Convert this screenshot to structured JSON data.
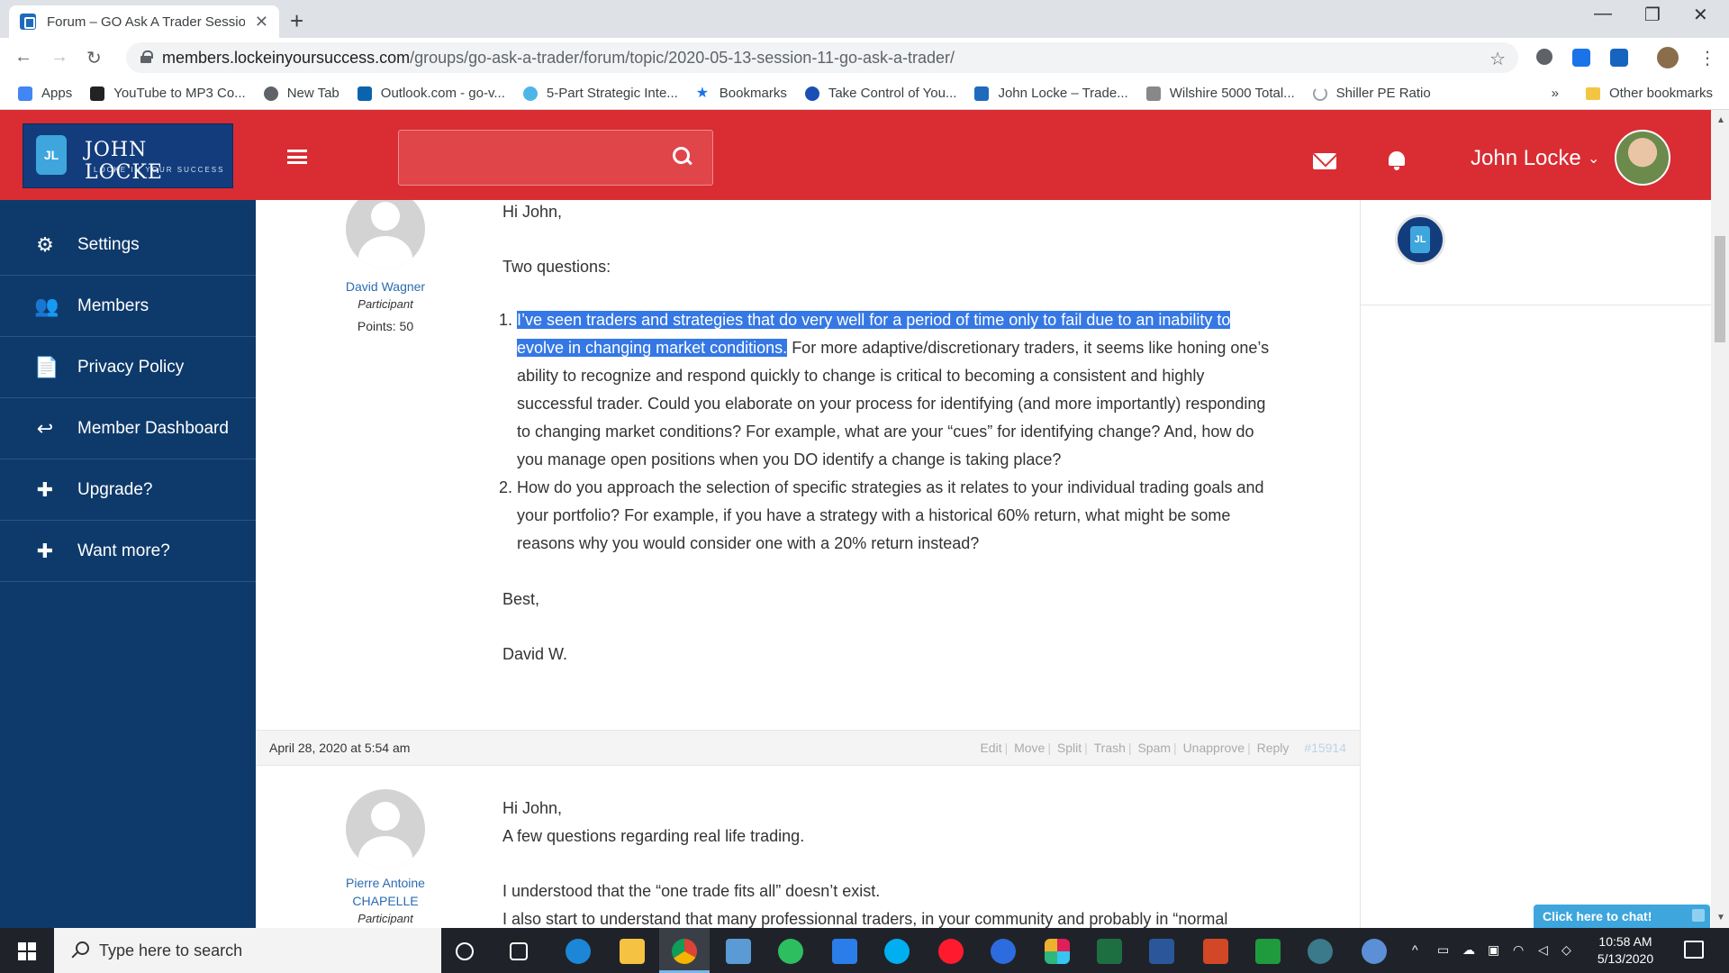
{
  "browser": {
    "tab_title": "Forum – GO Ask A Trader Session",
    "tab_close": "✕",
    "new_tab": "+",
    "url_domain": "members.lockeinyoursuccess.com",
    "url_path": "/groups/go-ask-a-trader/forum/topic/2020-05-13-session-11-go-ask-a-trader/",
    "bookmarks": [
      {
        "label": "Apps",
        "icon": "apps-icon",
        "color": "#4285f4"
      },
      {
        "label": "YouTube to MP3 Co...",
        "icon": "music-note-icon",
        "color": "#222222"
      },
      {
        "label": "New Tab",
        "icon": "globe-icon",
        "color": "#5f6368"
      },
      {
        "label": "Outlook.com - go-v...",
        "icon": "outlook-icon",
        "color": "#0a64ad"
      },
      {
        "label": "5-Part Strategic Inte...",
        "icon": "circle-icon",
        "color": "#4db6e6"
      },
      {
        "label": "Bookmarks",
        "icon": "star-icon",
        "color": "#1a73e8"
      },
      {
        "label": "Take Control of You...",
        "icon": "play-icon",
        "color": "#1a4fb5"
      },
      {
        "label": "John Locke – Trade...",
        "icon": "lock-icon",
        "color": "#1e6bbd"
      },
      {
        "label": "Wilshire 5000 Total...",
        "icon": "chart-icon",
        "color": "#888888"
      },
      {
        "label": "Shiller PE Ratio",
        "icon": "loading-icon",
        "color": "#9aa0a6"
      }
    ],
    "bookmarks_overflow": "»",
    "other_bookmarks": "Other bookmarks"
  },
  "header": {
    "logo_name": "JOHN LOCKE",
    "logo_tagline": "LOCKE IN YOUR SUCCESS",
    "logo_badge": "JL",
    "user_name": "John Locke",
    "user_chevron": "⌄"
  },
  "sidebar": {
    "items": [
      {
        "label": "Settings",
        "icon": "⚙"
      },
      {
        "label": "Members",
        "icon": "👥"
      },
      {
        "label": "Privacy Policy",
        "icon": "📄"
      },
      {
        "label": "Member Dashboard",
        "icon": "↩"
      },
      {
        "label": "Upgrade?",
        "icon": "✚"
      },
      {
        "label": "Want more?",
        "icon": "✚"
      }
    ]
  },
  "post1": {
    "author": "David Wagner",
    "role": "Participant",
    "points": "Points: 50",
    "greeting": "Hi John,",
    "intro": "Two questions:",
    "q1_highlight": "I’ve seen traders and strategies that do very well for a period of time only to fail due to an inability to evolve in changing market conditions.",
    "q1_rest": " For more adaptive/discretionary traders, it seems like honing one’s ability to recognize and respond quickly to change is critical to becoming a consistent and highly successful trader.  Could you elaborate on your process for identifying (and more importantly) responding to changing market conditions?  For example, what are your “cues” for identifying change?  And, how do you manage open positions when you DO identify a change is taking place?",
    "q2": "How do you approach the selection of specific strategies as it relates to your individual trading goals and your portfolio?  For example, if you have a strategy with a historical 60% return, what might be some reasons why you would consider one with a 20% return instead?",
    "closing": "Best,",
    "signature": "David W."
  },
  "meta": {
    "date": "April 28, 2020 at 5:54 am",
    "actions": [
      "Edit",
      "Move",
      "Split",
      "Trash",
      "Spam",
      "Unapprove",
      "Reply"
    ],
    "post_id": "#15914"
  },
  "post2": {
    "author_line1": "Pierre Antoine",
    "author_line2": "CHAPELLE",
    "role": "Participant",
    "greeting": "Hi John,",
    "line1": "A few questions regarding real life trading.",
    "line2": "I understood that the “one trade fits all” doesn’t exist.",
    "line3": "I also start to understand that many professionnal traders, in your community and probably in “normal"
  },
  "chat": {
    "label": "Click here to chat!"
  },
  "taskbar": {
    "search_placeholder": "Type here to search",
    "time": "10:58 AM",
    "date": "5/13/2020"
  }
}
